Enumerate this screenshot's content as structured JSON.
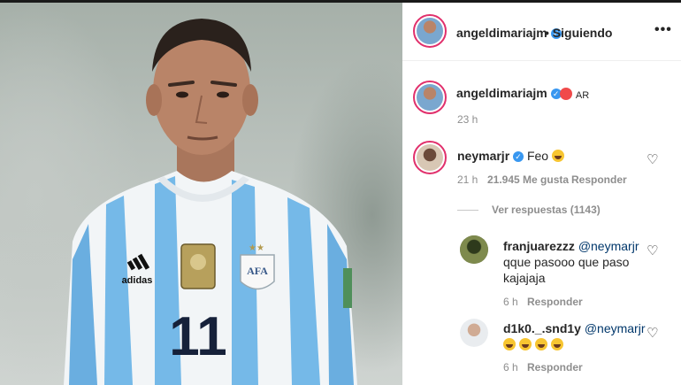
{
  "header": {
    "username": "angeldimariajm",
    "follow_status": "Siguiendo",
    "more_icon": "more-icon"
  },
  "caption": {
    "username": "angeldimariajm",
    "text": "AR",
    "time": "23 h"
  },
  "comments": [
    {
      "username": "neymarjr",
      "verified": true,
      "text": "Feo",
      "time": "21 h",
      "likes": "21.945 Me gusta",
      "reply_label": "Responder",
      "view_replies": "Ver respuestas (1143)"
    },
    {
      "username": "franjuarezzz",
      "mention": "@neymarjr",
      "text": "qque pasooo que paso kajajaja",
      "time": "6 h",
      "reply_label": "Responder"
    },
    {
      "username": "d1k0._.snd1y",
      "mention": "@neymarjr",
      "time": "6 h",
      "reply_label": "Responder"
    }
  ],
  "photo": {
    "jersey_number": "11",
    "brand": "adidas",
    "crest_text": "AFA"
  },
  "colors": {
    "verified": "#3897f0",
    "story_ring": "#e1306c",
    "jersey_blue": "#75b9e8",
    "jersey_white": "#f2f5f7"
  }
}
